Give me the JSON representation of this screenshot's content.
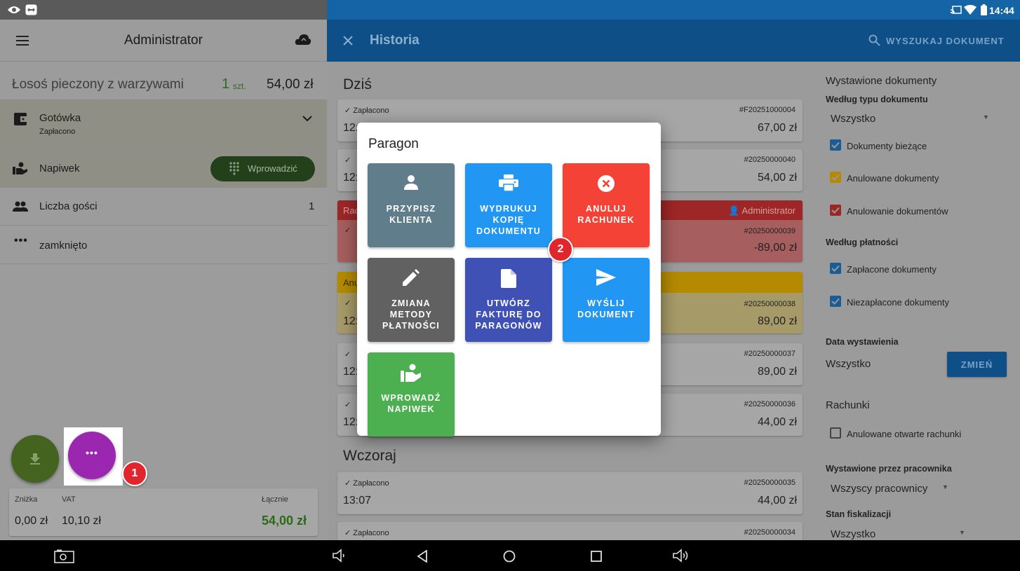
{
  "status_bar": {
    "time": "14:44"
  },
  "left_panel": {
    "title": "Administrator",
    "item": {
      "name": "Łosoś pieczony z warzywami",
      "qty": "1",
      "unit": "szt.",
      "price": "54,00 zł"
    },
    "payment": {
      "method": "Gotówka",
      "status": "Zapłacono"
    },
    "tip": {
      "label": "Napiwek",
      "button": "Wprowadzić"
    },
    "guests": {
      "label": "Liczba gości",
      "value": "1"
    },
    "closed": {
      "label": "zamknięto"
    },
    "totals": {
      "discount_label": "Zniżka",
      "discount_value": "0,00 zł",
      "vat_label": "VAT",
      "vat_value": "10,10 zł",
      "total_label": "Łącznie",
      "total_value": "54,00 zł"
    },
    "badge": "1"
  },
  "right_header": {
    "title": "Historia",
    "search_label": "WYSZUKAJ DOKUMENT"
  },
  "history": {
    "today_label": "Dziś",
    "yesterday_label": "Wczoraj",
    "cards": [
      {
        "status": "Zapłacono",
        "number": "#F20251000004",
        "time": "12:",
        "amount": "67,00 zł"
      },
      {
        "status": "",
        "number": "#20250000040",
        "time": "12:",
        "amount": "54,00 zł"
      },
      {
        "status": "Rac",
        "number": "#20250000039",
        "time": "",
        "amount": "-89,00 zł",
        "user": "Administrator"
      },
      {
        "status": "Anu",
        "number": "#20250000038",
        "time": "12:",
        "amount": "89,00 zł"
      },
      {
        "status": "",
        "number": "#20250000037",
        "time": "12:",
        "amount": "89,00 zł"
      },
      {
        "status": "",
        "number": "#20250000036",
        "time": "12:",
        "amount": "44,00 zł"
      },
      {
        "status": "Zapłacono",
        "number": "#20250000035",
        "time": "13:07",
        "amount": "44,00 zł"
      },
      {
        "status": "Zapłacono",
        "number": "#20250000034",
        "time": "",
        "amount": ""
      }
    ]
  },
  "filters": {
    "section_title": "Wystawione dokumenty",
    "by_type_label": "Według typu dokumentu",
    "by_type_value": "Wszystko",
    "type_checks": [
      "Dokumenty bieżące",
      "Anulowane dokumenty",
      "Anulowanie dokumentów"
    ],
    "by_payment_label": "Według płatności",
    "payment_checks": [
      "Zapłacone dokumenty",
      "Niezapłacone dokumenty"
    ],
    "date_label": "Data wystawienia",
    "date_value": "Wszystko",
    "date_button": "ZMIEŃ",
    "bills_label": "Rachunki",
    "bills_check": "Anulowane otwarte rachunki",
    "employee_label": "Wystawione przez pracownika",
    "employee_value": "Wszyscy pracownicy",
    "fiscal_label": "Stan fiskalizacji",
    "fiscal_value": "Wszystko",
    "colors": {
      "blue": "#1a5c95",
      "yellow": "#b58a00",
      "red": "#9d2727"
    }
  },
  "dialog": {
    "title": "Paragon",
    "tiles": [
      {
        "label": "PRZYPISZ\nKLIENTA",
        "icon": "person-icon",
        "color": "#607d8b"
      },
      {
        "label": "WYDRUKUJ\nKOPIĘ\nDOKUMENTU",
        "icon": "printer-icon",
        "color": "#2196f3"
      },
      {
        "label": "ANULUJ\nRACHUNEK",
        "icon": "cancel-icon",
        "color": "#f44336"
      },
      {
        "label": "ZMIANA\nMETODY\nPŁATNOŚCI",
        "icon": "pencil-icon",
        "color": "#616161"
      },
      {
        "label": "UTWÓRZ\nFAKTURĘ DO\nPARAGONÓW",
        "icon": "document-icon",
        "color": "#3f51b5"
      },
      {
        "label": "WYŚLIJ\nDOKUMENT",
        "icon": "send-icon",
        "color": "#2196f3"
      },
      {
        "label": "WPROWADŹ\nNAPIWEK",
        "icon": "tip-icon",
        "color": "#4caf50"
      }
    ],
    "badge": "2"
  }
}
